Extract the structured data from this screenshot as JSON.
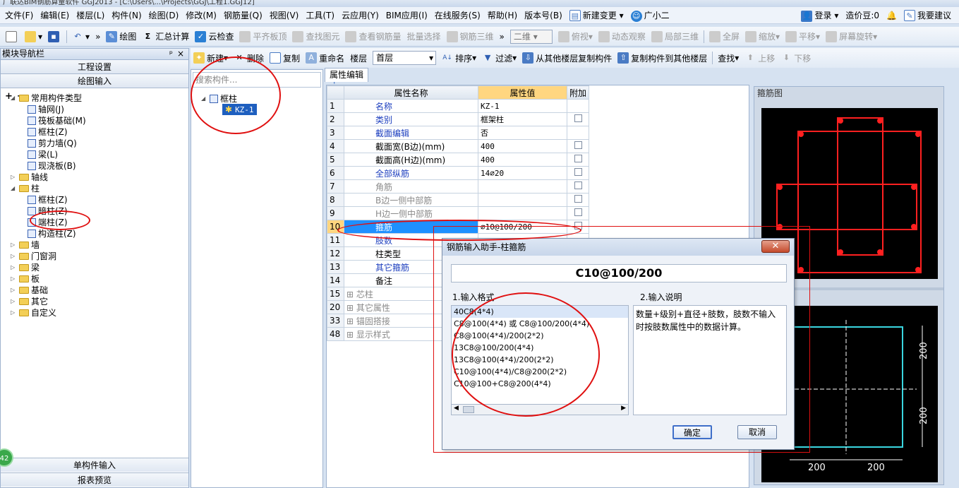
{
  "title_bar": "广联达BIM钢筋算量软件 GGJ2013 - [C:\\Users\\...\\Projects\\GGJ\\工程1.GGJ12]",
  "menu": [
    "文件(F)",
    "编辑(E)",
    "楼层(L)",
    "构件(N)",
    "绘图(D)",
    "修改(M)",
    "钢筋量(Q)",
    "视图(V)",
    "工具(T)",
    "云应用(Y)",
    "BIM应用(I)",
    "在线服务(S)",
    "帮助(H)",
    "版本号(B)",
    "新建变更 ▾",
    "广小二"
  ],
  "menu_right": {
    "login": "登录",
    "beans": "造价豆:0",
    "suggest": "我要建议"
  },
  "toolbar": {
    "items": [
      "绘图",
      "汇总计算",
      "云检查",
      "平齐板顶",
      "查找图元",
      "查看钢筋量",
      "批量选择",
      "钢筋三维"
    ],
    "view_select": "二维",
    "view_items": [
      "俯视",
      "动态观察",
      "局部三维",
      "全屏",
      "缩放",
      "平移",
      "屏幕旋转"
    ]
  },
  "nav": {
    "header": "模块导航栏",
    "pin": "ᵖ",
    "close": "×",
    "btn_project": "工程设置",
    "btn_draw": "绘图输入",
    "tree": [
      {
        "label": "常用构件类型",
        "level": 0,
        "type": "folder",
        "expanded": true
      },
      {
        "label": "轴网(J)",
        "level": 1,
        "type": "item"
      },
      {
        "label": "筏板基础(M)",
        "level": 1,
        "type": "item"
      },
      {
        "label": "框柱(Z)",
        "level": 1,
        "type": "item"
      },
      {
        "label": "剪力墙(Q)",
        "level": 1,
        "type": "item"
      },
      {
        "label": "梁(L)",
        "level": 1,
        "type": "item"
      },
      {
        "label": "现浇板(B)",
        "level": 1,
        "type": "item"
      },
      {
        "label": "轴线",
        "level": 0,
        "type": "folder",
        "expanded": false
      },
      {
        "label": "柱",
        "level": 0,
        "type": "folder",
        "expanded": true
      },
      {
        "label": "框柱(Z)",
        "level": 1,
        "type": "item"
      },
      {
        "label": "暗柱(Z)",
        "level": 1,
        "type": "item"
      },
      {
        "label": "端柱(Z)",
        "level": 1,
        "type": "item"
      },
      {
        "label": "构造柱(Z)",
        "level": 1,
        "type": "item"
      },
      {
        "label": "墙",
        "level": 0,
        "type": "folder",
        "expanded": false
      },
      {
        "label": "门窗洞",
        "level": 0,
        "type": "folder",
        "expanded": false
      },
      {
        "label": "梁",
        "level": 0,
        "type": "folder",
        "expanded": false
      },
      {
        "label": "板",
        "level": 0,
        "type": "folder",
        "expanded": false
      },
      {
        "label": "基础",
        "level": 0,
        "type": "folder",
        "expanded": false
      },
      {
        "label": "其它",
        "level": 0,
        "type": "folder",
        "expanded": false
      },
      {
        "label": "自定义",
        "level": 0,
        "type": "folder",
        "expanded": false
      }
    ],
    "btn_single": "单构件输入",
    "btn_report": "报表预览",
    "badge": "42"
  },
  "comp_toolbar": {
    "new": "新建",
    "delete": "删除",
    "copy": "复制",
    "rename": "重命名",
    "floor_label": "楼层",
    "floor_value": "首层",
    "sort": "排序",
    "filter": "过滤",
    "copy_from": "从其他楼层复制构件",
    "copy_to": "复制构件到其他楼层",
    "find": "查找",
    "up": "上移",
    "down": "下移"
  },
  "comp_list": {
    "search_placeholder": "搜索构件...",
    "group": "框柱",
    "item": "KZ-1"
  },
  "props": {
    "tab": "属性编辑",
    "col_name": "属性名称",
    "col_value": "属性值",
    "col_extra": "附加",
    "rows": [
      {
        "no": "1",
        "name": "名称",
        "value": "KZ-1",
        "style": "blue",
        "chk": false
      },
      {
        "no": "2",
        "name": "类别",
        "value": "框架柱",
        "style": "blue",
        "chk": true
      },
      {
        "no": "3",
        "name": "截面编辑",
        "value": "否",
        "style": "blue",
        "chk": false
      },
      {
        "no": "4",
        "name": "截面宽(B边)(mm)",
        "value": "400",
        "style": "black",
        "chk": true
      },
      {
        "no": "5",
        "name": "截面高(H边)(mm)",
        "value": "400",
        "style": "black",
        "chk": true
      },
      {
        "no": "6",
        "name": "全部纵筋",
        "value": "14⌀20",
        "style": "blue",
        "chk": true
      },
      {
        "no": "7",
        "name": "角筋",
        "value": "",
        "style": "gray",
        "chk": true
      },
      {
        "no": "8",
        "name": "B边一侧中部筋",
        "value": "",
        "style": "gray",
        "chk": true
      },
      {
        "no": "9",
        "name": "H边一侧中部筋",
        "value": "",
        "style": "gray",
        "chk": true
      },
      {
        "no": "10",
        "name": "箍筋",
        "value": "⌀10@100/200",
        "style": "selected",
        "chk": true
      },
      {
        "no": "11",
        "name": "肢数",
        "value": "",
        "style": "blue",
        "chk": false
      },
      {
        "no": "12",
        "name": "柱类型",
        "value": "",
        "style": "black",
        "chk": false
      },
      {
        "no": "13",
        "name": "其它箍筋",
        "value": "",
        "style": "blue",
        "chk": false
      },
      {
        "no": "14",
        "name": "备注",
        "value": "",
        "style": "black",
        "chk": false
      },
      {
        "no": "15",
        "name": "芯柱",
        "value": "",
        "style": "gray",
        "chk": false,
        "plus": true
      },
      {
        "no": "20",
        "name": "其它属性",
        "value": "",
        "style": "gray",
        "chk": false,
        "plus": true
      },
      {
        "no": "33",
        "name": "锚固搭接",
        "value": "",
        "style": "gray",
        "chk": false,
        "plus": true
      },
      {
        "no": "48",
        "name": "显示样式",
        "value": "",
        "style": "gray",
        "chk": false,
        "plus": true
      }
    ]
  },
  "preview": {
    "title": "箍筋图",
    "dims": [
      "200",
      "200",
      "200",
      "200"
    ]
  },
  "dialog": {
    "title": "钢筋输入助手-柱箍筋",
    "close": "✕",
    "value": "C10@100/200",
    "section1": "1.输入格式",
    "section2": "2.输入说明",
    "formats": [
      "40C8(4*4)",
      "C8@100(4*4) 或 C8@100/200(4*4)",
      "C8@100(4*4)/200(2*2)",
      "13C8@100/200(4*4)",
      "13C8@100(4*4)/200(2*2)",
      "C10@100(4*4)/C8@200(2*2)",
      "C10@100+C8@200(4*4)"
    ],
    "description": "数量+级别+直径+肢数，肢数不输入时按肢数属性中的数据计算。",
    "ok": "确定",
    "cancel": "取消"
  },
  "colors": {
    "accent": "#3f6fc9",
    "selection": "#1e90ff",
    "annotation": "#e01010",
    "rebar_red": "#ff2020",
    "rebar_cyan": "#3ad6e0"
  }
}
